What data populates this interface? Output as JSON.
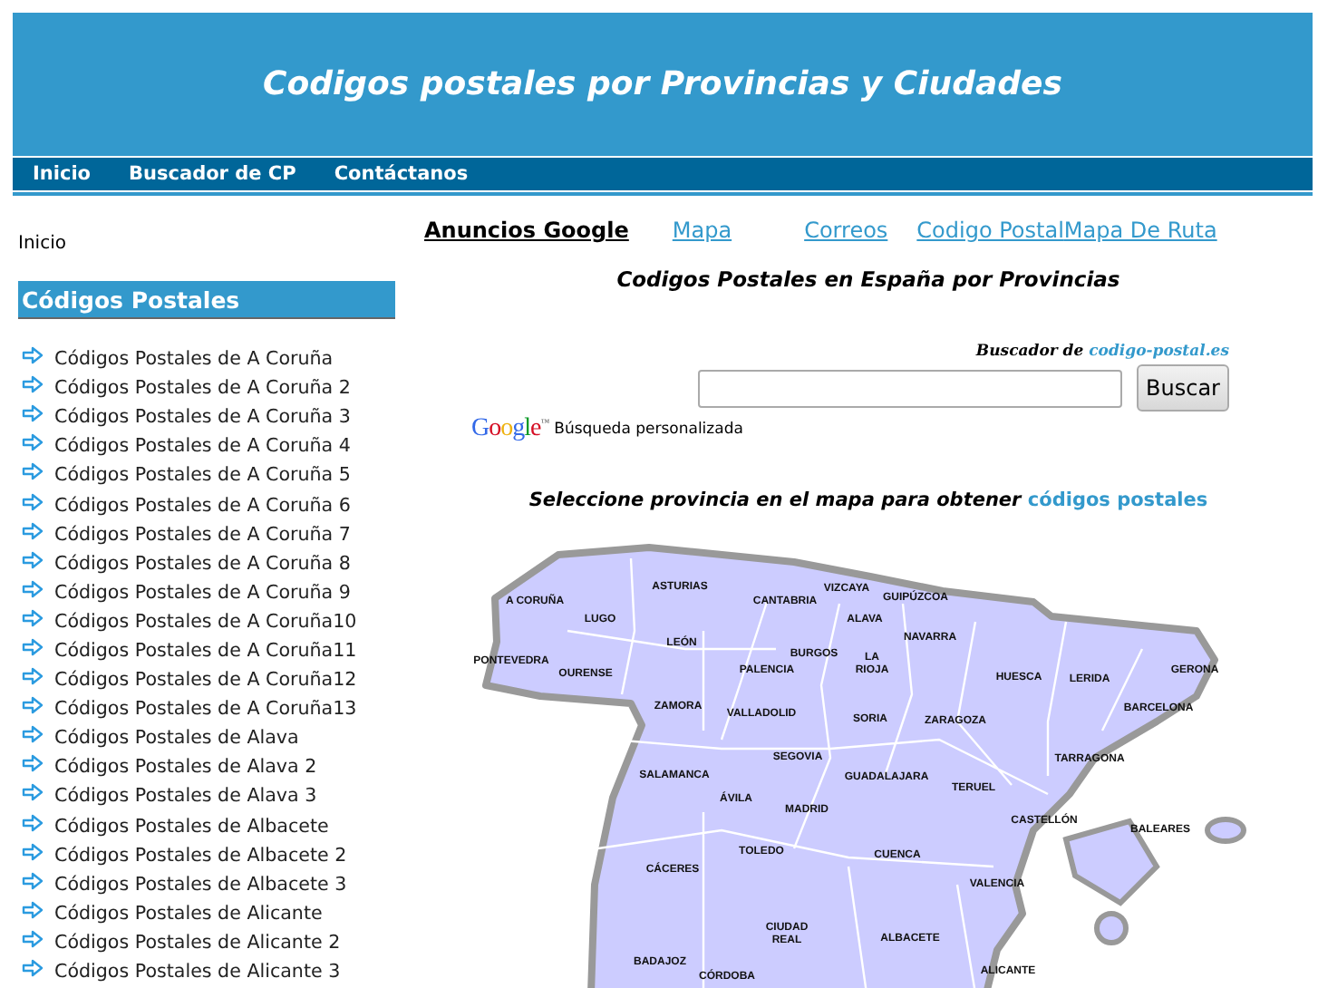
{
  "header": {
    "title": "Codigos postales por Provincias y Ciudades"
  },
  "nav": [
    {
      "label": "Inicio"
    },
    {
      "label": "Buscador de CP"
    },
    {
      "label": "Contáctanos"
    }
  ],
  "breadcrumb": "Inicio",
  "sidebar": {
    "heading": "Códigos Postales",
    "items": [
      "Códigos Postales de A Coruña",
      "Códigos Postales de A Coruña 2",
      "Códigos Postales de A Coruña 3",
      "Códigos Postales de A Coruña 4",
      "Códigos Postales de A Coruña 5",
      "Códigos Postales de A Coruña 6",
      "Códigos Postales de A Coruña 7",
      "Códigos Postales de A Coruña 8",
      "Códigos Postales de A Coruña 9",
      "Códigos Postales de A Coruña10",
      "Códigos Postales de A Coruña11",
      "Códigos Postales de A Coruña12",
      "Códigos Postales de A Coruña13",
      "Códigos Postales de Alava",
      "Códigos Postales de Alava 2",
      "Códigos Postales de Alava 3",
      "Códigos Postales de Albacete",
      "Códigos Postales de Albacete 2",
      "Códigos Postales de Albacete 3",
      "Códigos Postales de Alicante",
      "Códigos Postales de Alicante 2",
      "Códigos Postales de Alicante 3"
    ]
  },
  "ad_links": {
    "label": "Anuncios Google",
    "links": [
      "Mapa",
      "Correos",
      "Codigo Postal",
      "Mapa De Ruta"
    ]
  },
  "heading": "Codigos Postales en España por Provincias",
  "search": {
    "caption": "Buscador de",
    "caption_link": "codigo-postal.es",
    "button": "Buscar",
    "logo": "Google",
    "logo_mark": "™",
    "powered": "Búsqueda personalizada"
  },
  "map_prompt": {
    "text": "Seleccione provincia en el mapa para obtener",
    "link": "códigos postales"
  },
  "map": {
    "provinces": [
      "A CORUÑA",
      "LUGO",
      "ASTURIAS",
      "CANTABRIA",
      "VIZCAYA",
      "GUIPÚZCOA",
      "ALAVA",
      "NAVARRA",
      "PONTEVEDRA",
      "OURENSE",
      "LEÓN",
      "PALENCIA",
      "BURGOS",
      "LA RIOJA",
      "HUESCA",
      "LERIDA",
      "GERONA",
      "BARCELONA",
      "ZAMORA",
      "VALLADOLID",
      "SORIA",
      "ZARAGOZA",
      "TARRAGONA",
      "SEGOVIA",
      "SALAMANCA",
      "GUADALAJARA",
      "TERUEL",
      "ÁVILA",
      "MADRID",
      "CASTELLÓN",
      "BALEARES",
      "TOLEDO",
      "CUENCA",
      "CÁCERES",
      "VALENCIA",
      "CIUDAD REAL",
      "ALBACETE",
      "BADAJOZ",
      "ALICANTE",
      "CÓRDOBA"
    ]
  }
}
